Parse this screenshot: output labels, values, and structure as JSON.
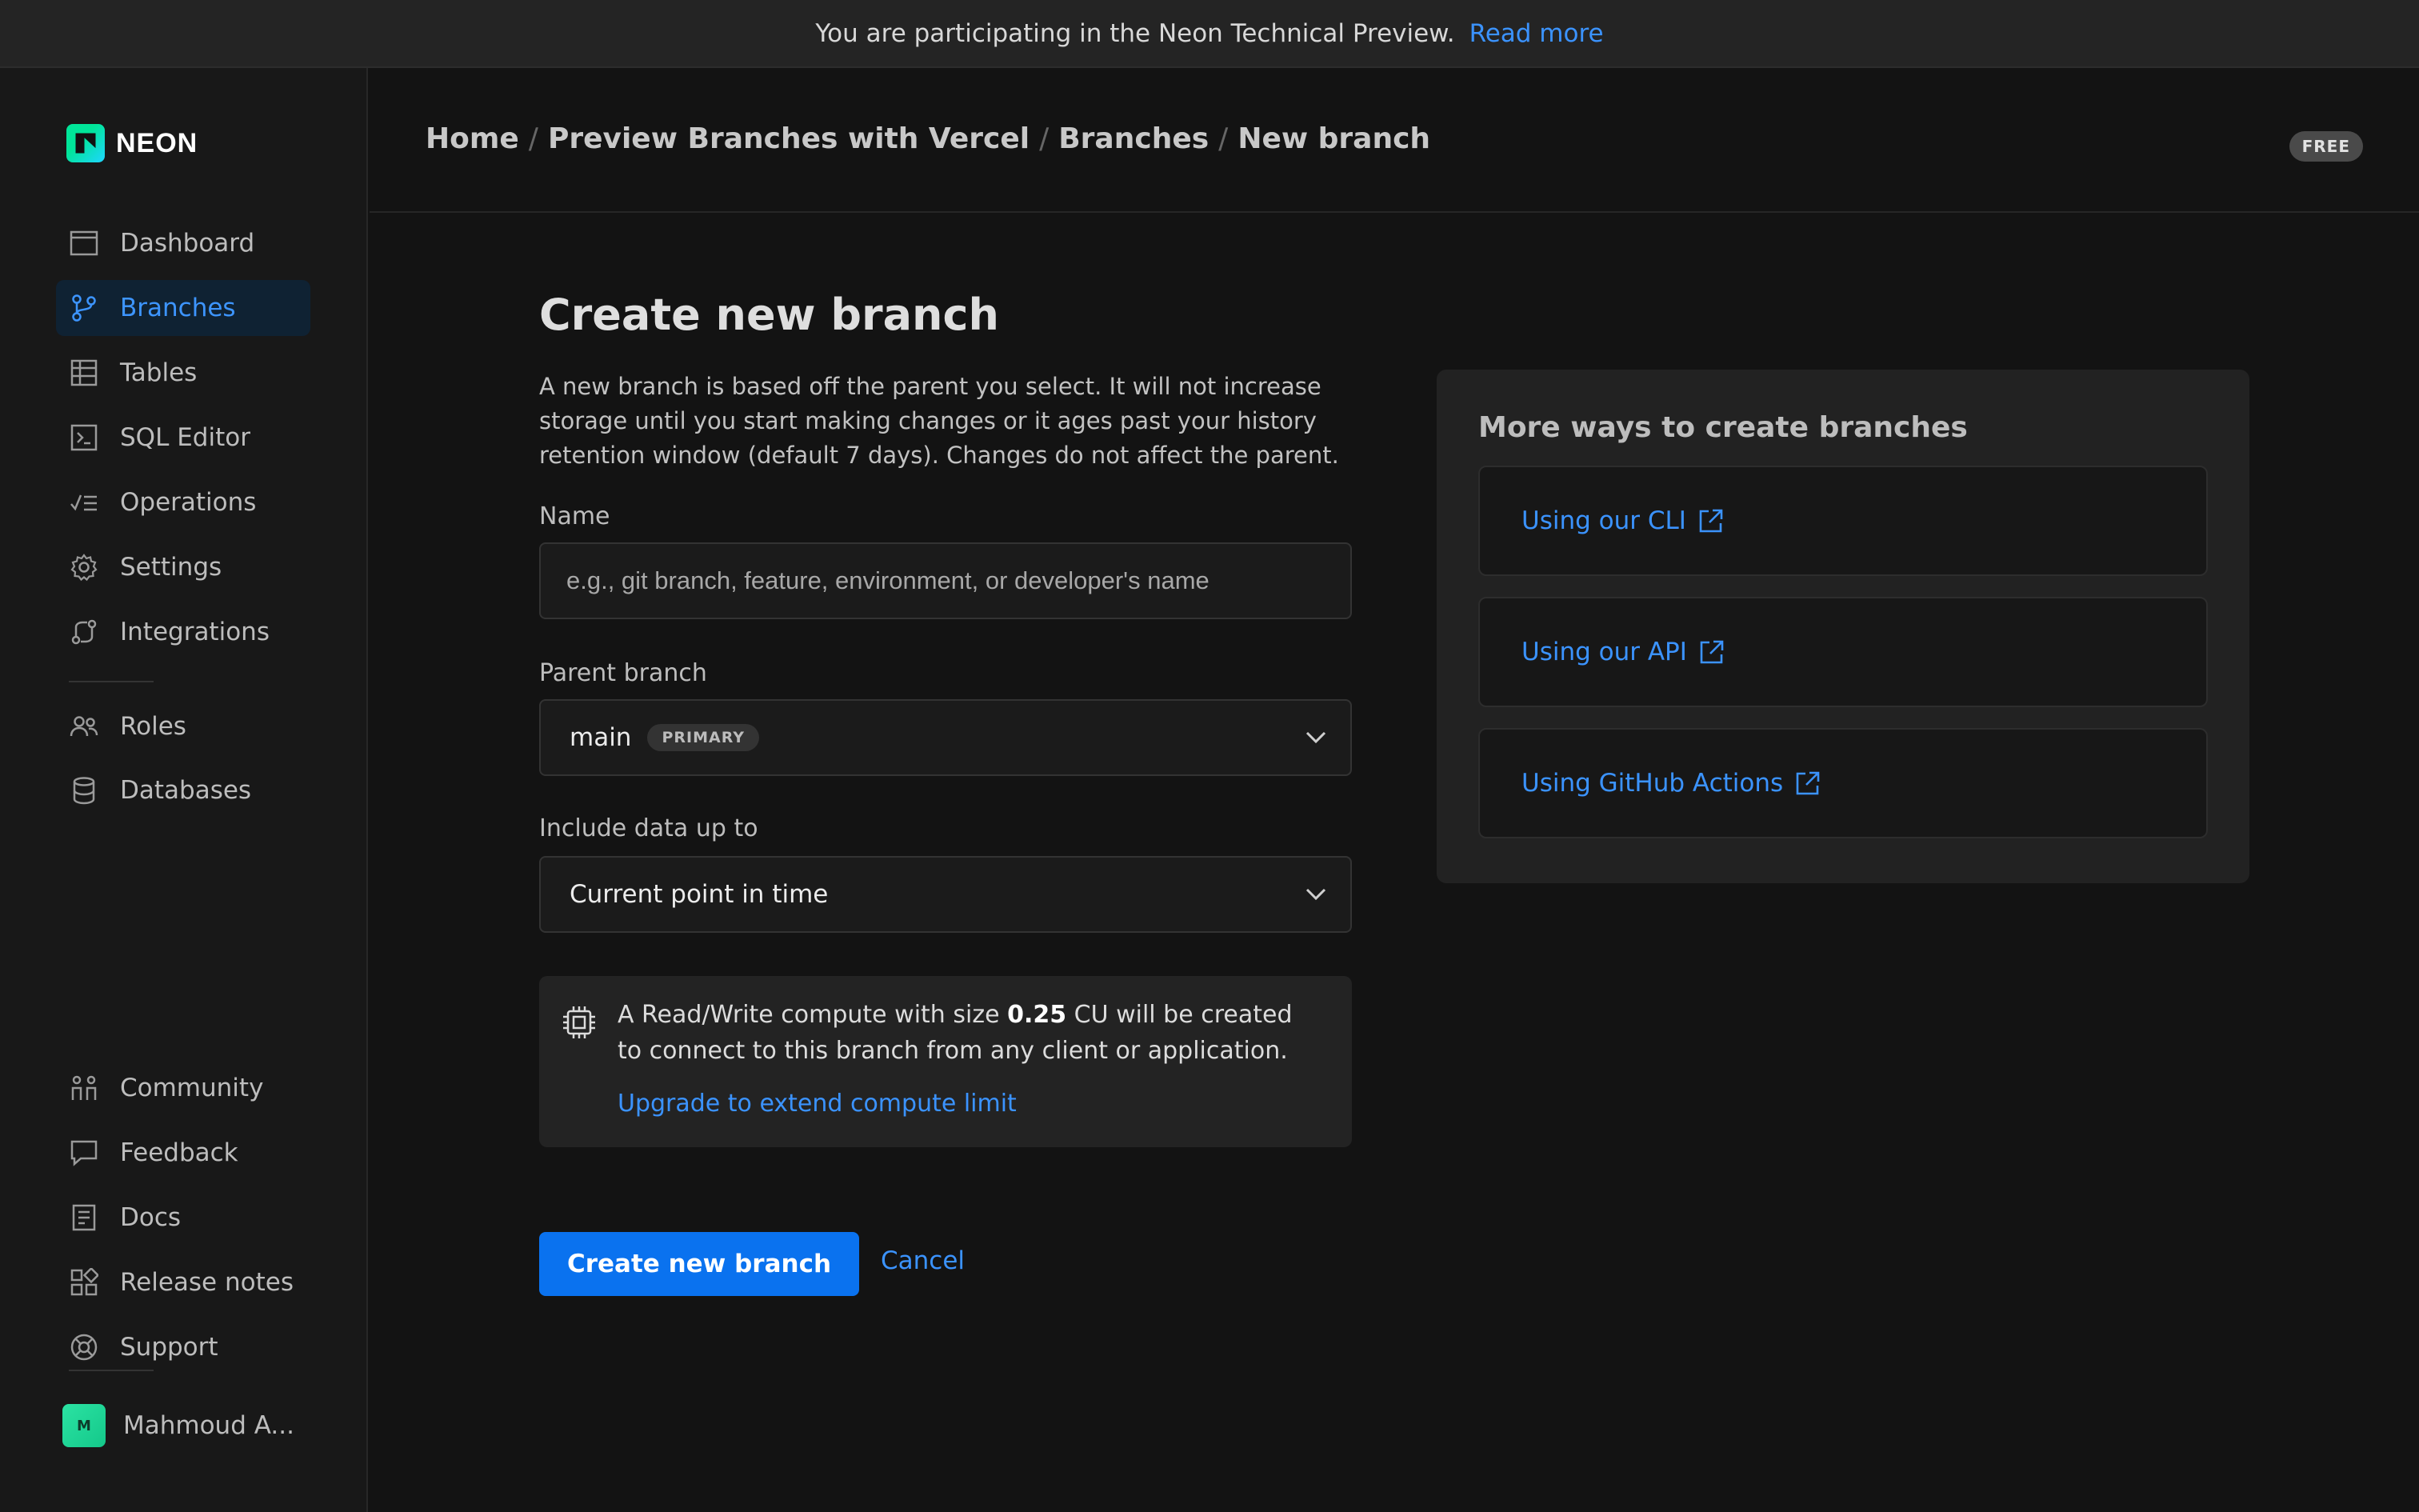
{
  "banner": {
    "message": "You are participating in the Neon Technical Preview.",
    "link": "Read more"
  },
  "logo": {
    "text": "NEON"
  },
  "sidebar": {
    "items": [
      {
        "label": "Dashboard",
        "icon": "dashboard-icon"
      },
      {
        "label": "Branches",
        "icon": "branch-icon",
        "active": true
      },
      {
        "label": "Tables",
        "icon": "table-icon"
      },
      {
        "label": "SQL Editor",
        "icon": "terminal-icon"
      },
      {
        "label": "Operations",
        "icon": "operations-icon"
      },
      {
        "label": "Settings",
        "icon": "gear-icon"
      },
      {
        "label": "Integrations",
        "icon": "integrations-icon"
      }
    ],
    "items2": [
      {
        "label": "Roles",
        "icon": "users-icon"
      },
      {
        "label": "Databases",
        "icon": "database-icon"
      }
    ],
    "bottom": [
      {
        "label": "Community",
        "icon": "community-icon"
      },
      {
        "label": "Feedback",
        "icon": "chat-icon"
      },
      {
        "label": "Docs",
        "icon": "docs-icon"
      },
      {
        "label": "Release notes",
        "icon": "release-notes-icon"
      },
      {
        "label": "Support",
        "icon": "lifebuoy-icon"
      }
    ],
    "user": {
      "initials": "M",
      "name": "Mahmoud A..."
    }
  },
  "header": {
    "breadcrumb": [
      "Home",
      "Preview Branches with Vercel",
      "Branches",
      "New branch"
    ],
    "separator": "/",
    "plan": "FREE"
  },
  "form": {
    "title": "Create new branch",
    "description": "A new branch is based off the parent you select. It will not increase storage until you start making changes or it ages past your history retention window (default 7 days). Changes do not affect the parent.",
    "name_label": "Name",
    "name_placeholder": "e.g., git branch, feature, environment, or developer's name",
    "name_value": "",
    "parent_label": "Parent branch",
    "parent_value": "main",
    "parent_badge": "PRIMARY",
    "include_label": "Include data up to",
    "include_value": "Current point in time",
    "info_prefix": "A Read/Write compute with size",
    "info_size": "0.25",
    "info_suffix": "CU will be created to connect to this branch from any client or application.",
    "info_link": "Upgrade to extend compute limit",
    "submit": "Create new branch",
    "cancel": "Cancel"
  },
  "more_ways": {
    "title": "More ways to create branches",
    "links": [
      "Using our CLI",
      "Using our API",
      "Using GitHub Actions"
    ]
  },
  "colors": {
    "accent": "#3b93ff",
    "primary_button": "#0a72ef",
    "background": "#131313",
    "brand_green": "#00e599"
  }
}
